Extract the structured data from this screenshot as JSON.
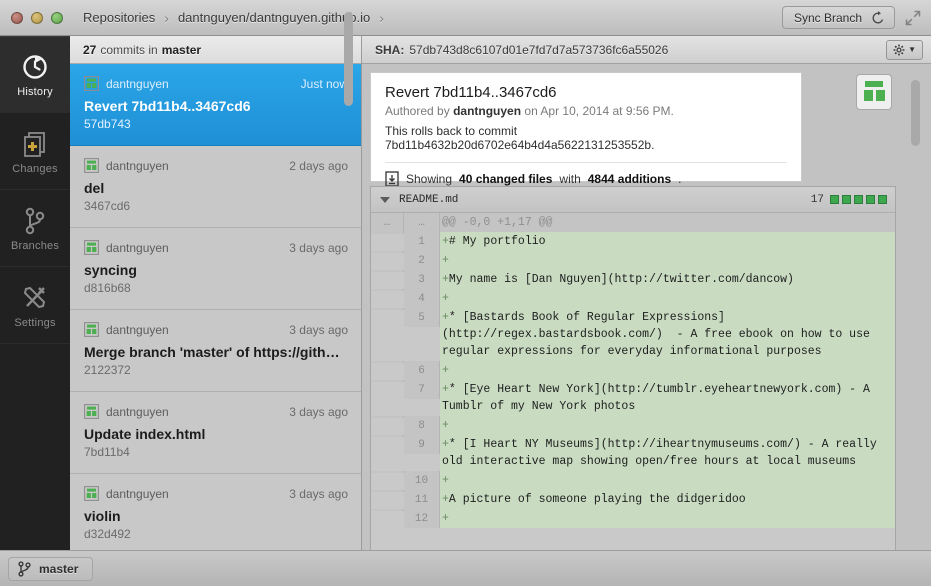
{
  "titlebar": {
    "breadcrumb": [
      "Repositories",
      "dantnguyen/dantnguyen.github.io"
    ],
    "separator": "›",
    "sync_label": "Sync Branch",
    "sync_icon": "refresh-icon",
    "fullscreen_icon": "fullscreen-icon"
  },
  "sidebar": {
    "items": [
      {
        "label": "History",
        "icon": "history-icon",
        "active": true
      },
      {
        "label": "Changes",
        "icon": "changes-icon",
        "active": false
      },
      {
        "label": "Branches",
        "icon": "branches-icon",
        "active": false
      },
      {
        "label": "Settings",
        "icon": "settings-icon",
        "active": false
      }
    ]
  },
  "commit_list": {
    "header": {
      "count": "27",
      "text_mid": "commits in",
      "branch": "master"
    },
    "commits": [
      {
        "author": "dantnguyen",
        "when": "Just now",
        "message": "Revert 7bd11b4..3467cd6",
        "sha": "57db743",
        "selected": true
      },
      {
        "author": "dantnguyen",
        "when": "2 days ago",
        "message": "del",
        "sha": "3467cd6",
        "selected": false
      },
      {
        "author": "dantnguyen",
        "when": "3 days ago",
        "message": "syncing",
        "sha": "d816b68",
        "selected": false
      },
      {
        "author": "dantnguyen",
        "when": "3 days ago",
        "message": "Merge branch 'master' of https://githu…",
        "sha": "2122372",
        "selected": false
      },
      {
        "author": "dantnguyen",
        "when": "3 days ago",
        "message": "Update index.html",
        "sha": "7bd11b4",
        "selected": false
      },
      {
        "author": "dantnguyen",
        "when": "3 days ago",
        "message": "violin",
        "sha": "d32d492",
        "selected": false
      }
    ]
  },
  "detail": {
    "sha_label": "SHA:",
    "sha_value": "57db743d8c6107d01e7fd7d7a573736fc6a55026",
    "gear_icon": "gear-icon",
    "summary": {
      "title": "Revert 7bd11b4..3467cd6",
      "authored_prefix": "Authored by",
      "author": "dantnguyen",
      "authored_suffix": "on Apr 10, 2014 at 9:56 PM.",
      "body": "This rolls back to commit 7bd11b4632b20d6702e64b4d4a5622131253552b.",
      "files_prefix": "Showing",
      "files_count": "40 changed files",
      "files_mid": "with",
      "additions": "4844 additions",
      "files_suffix": ".",
      "file_icon": "file-diff-icon"
    },
    "diff": {
      "filename": "README.md",
      "stat_number": "17",
      "stat_squares": 5,
      "rows": [
        {
          "type": "hunk",
          "old": "…",
          "new": "…",
          "marker": "",
          "text": "@@ -0,0 +1,17 @@"
        },
        {
          "type": "add",
          "old": "",
          "new": "1",
          "marker": "+",
          "text": "# My portfolio"
        },
        {
          "type": "add",
          "old": "",
          "new": "2",
          "marker": "+",
          "text": ""
        },
        {
          "type": "add",
          "old": "",
          "new": "3",
          "marker": "+",
          "text": "My name is [Dan Nguyen](http://twitter.com/dancow)"
        },
        {
          "type": "add",
          "old": "",
          "new": "4",
          "marker": "+",
          "text": ""
        },
        {
          "type": "add",
          "old": "",
          "new": "5",
          "marker": "+",
          "text": "* [Bastards Book of Regular Expressions](http://regex.bastardsbook.com/)  - A free ebook on how to use regular expressions for everyday informational purposes"
        },
        {
          "type": "add",
          "old": "",
          "new": "6",
          "marker": "+",
          "text": ""
        },
        {
          "type": "add",
          "old": "",
          "new": "7",
          "marker": "+",
          "text": "* [Eye Heart New York](http://tumblr.eyeheartnewyork.com) - A Tumblr of my New York photos"
        },
        {
          "type": "add",
          "old": "",
          "new": "8",
          "marker": "+",
          "text": ""
        },
        {
          "type": "add",
          "old": "",
          "new": "9",
          "marker": "+",
          "text": "* [I Heart NY Museums](http://iheartnymuseums.com/) - A really old interactive map showing open/free hours at local museums"
        },
        {
          "type": "add",
          "old": "",
          "new": "10",
          "marker": "+",
          "text": ""
        },
        {
          "type": "add",
          "old": "",
          "new": "11",
          "marker": "+",
          "text": "A picture of someone playing the didgeridoo"
        },
        {
          "type": "add",
          "old": "",
          "new": "12",
          "marker": "+",
          "text": ""
        }
      ]
    }
  },
  "statusbar": {
    "branch": "master",
    "branch_icon": "branch-icon"
  },
  "colors": {
    "selection_blue": "#2ba6e8",
    "diff_add_green": "#c9dcc2",
    "stat_green": "#3ea84f",
    "sidebar_dark": "#212121"
  }
}
